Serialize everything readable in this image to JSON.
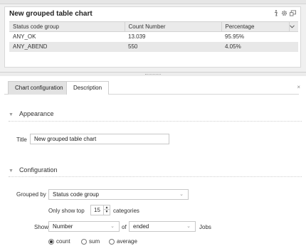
{
  "widget": {
    "title": "New grouped table chart",
    "columns": [
      "Status code group",
      "Count Number",
      "Percentage"
    ],
    "rows": [
      {
        "group": "ANY_OK",
        "count": "13.039",
        "percent": "95.95%"
      },
      {
        "group": "ANY_ABEND",
        "count": "550",
        "percent": "4.05%"
      }
    ],
    "tools": [
      "info-icon",
      "gear-icon",
      "window-icon"
    ]
  },
  "tabs": [
    {
      "label": "Chart configuration",
      "active": true
    },
    {
      "label": "Description",
      "active": false
    }
  ],
  "close_label": "×",
  "appearance": {
    "heading": "Appearance",
    "title_label": "Title",
    "title_value": "New grouped table chart"
  },
  "configuration": {
    "heading": "Configuration",
    "grouped_by_label": "Grouped by",
    "grouped_by_value": "Status code group",
    "only_show_top_label": "Only show top",
    "top_value": "15",
    "categories_label": "categories",
    "show_label": "Show",
    "show_value": "Number",
    "of_label": "of",
    "of_value": "ended",
    "jobs_label": "Jobs",
    "aggregate_options": [
      "count",
      "sum",
      "average"
    ],
    "aggregate_selected": "count"
  },
  "colors": {
    "header_bg": "#eaeaea",
    "alt_row_bg": "#e8e8e8",
    "active_tab_bg": "#e2e2e2"
  }
}
